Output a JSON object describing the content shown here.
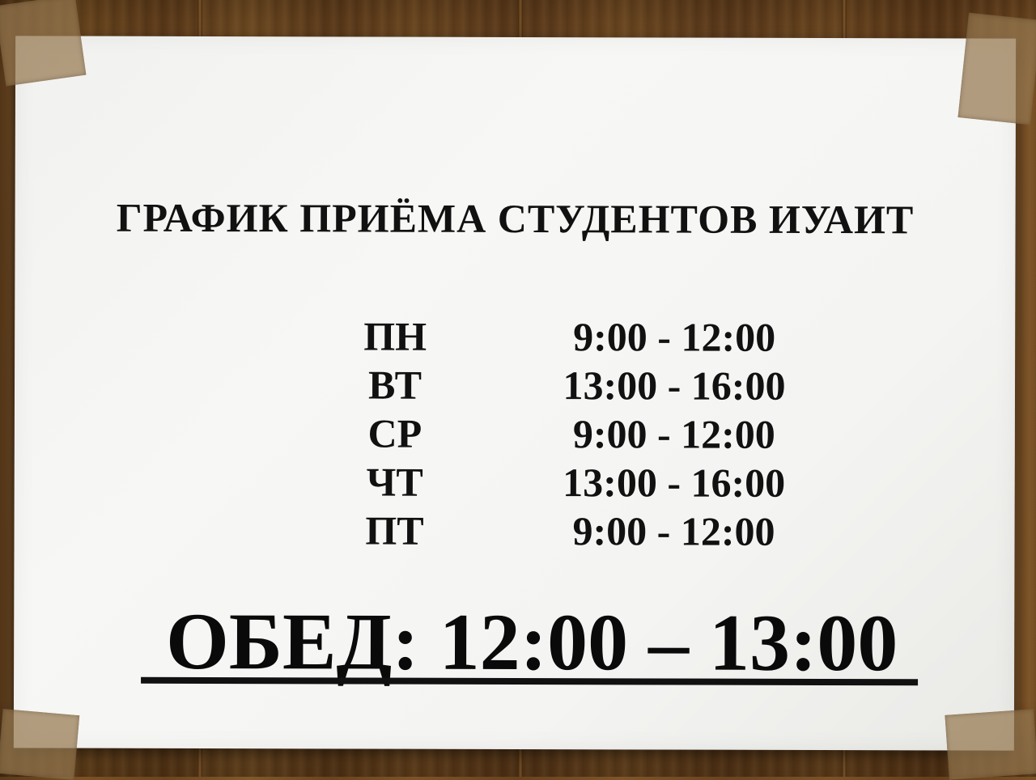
{
  "notice": {
    "title": "ГРАФИК ПРИЁМА СТУДЕНТОВ ИУАИТ",
    "schedule": [
      {
        "day": "ПН",
        "time": "9:00 - 12:00"
      },
      {
        "day": "ВТ",
        "time": "13:00 - 16:00"
      },
      {
        "day": "СР",
        "time": "9:00 - 12:00"
      },
      {
        "day": "ЧТ",
        "time": "13:00 - 16:00"
      },
      {
        "day": "ПТ",
        "time": "9:00 - 12:00"
      }
    ],
    "lunch": "ОБЕД: 12:00 – 13:00"
  },
  "colors": {
    "paper": "#f4f4f2",
    "text": "#111111",
    "wood": "#6b4520",
    "tape": "#96784f"
  }
}
